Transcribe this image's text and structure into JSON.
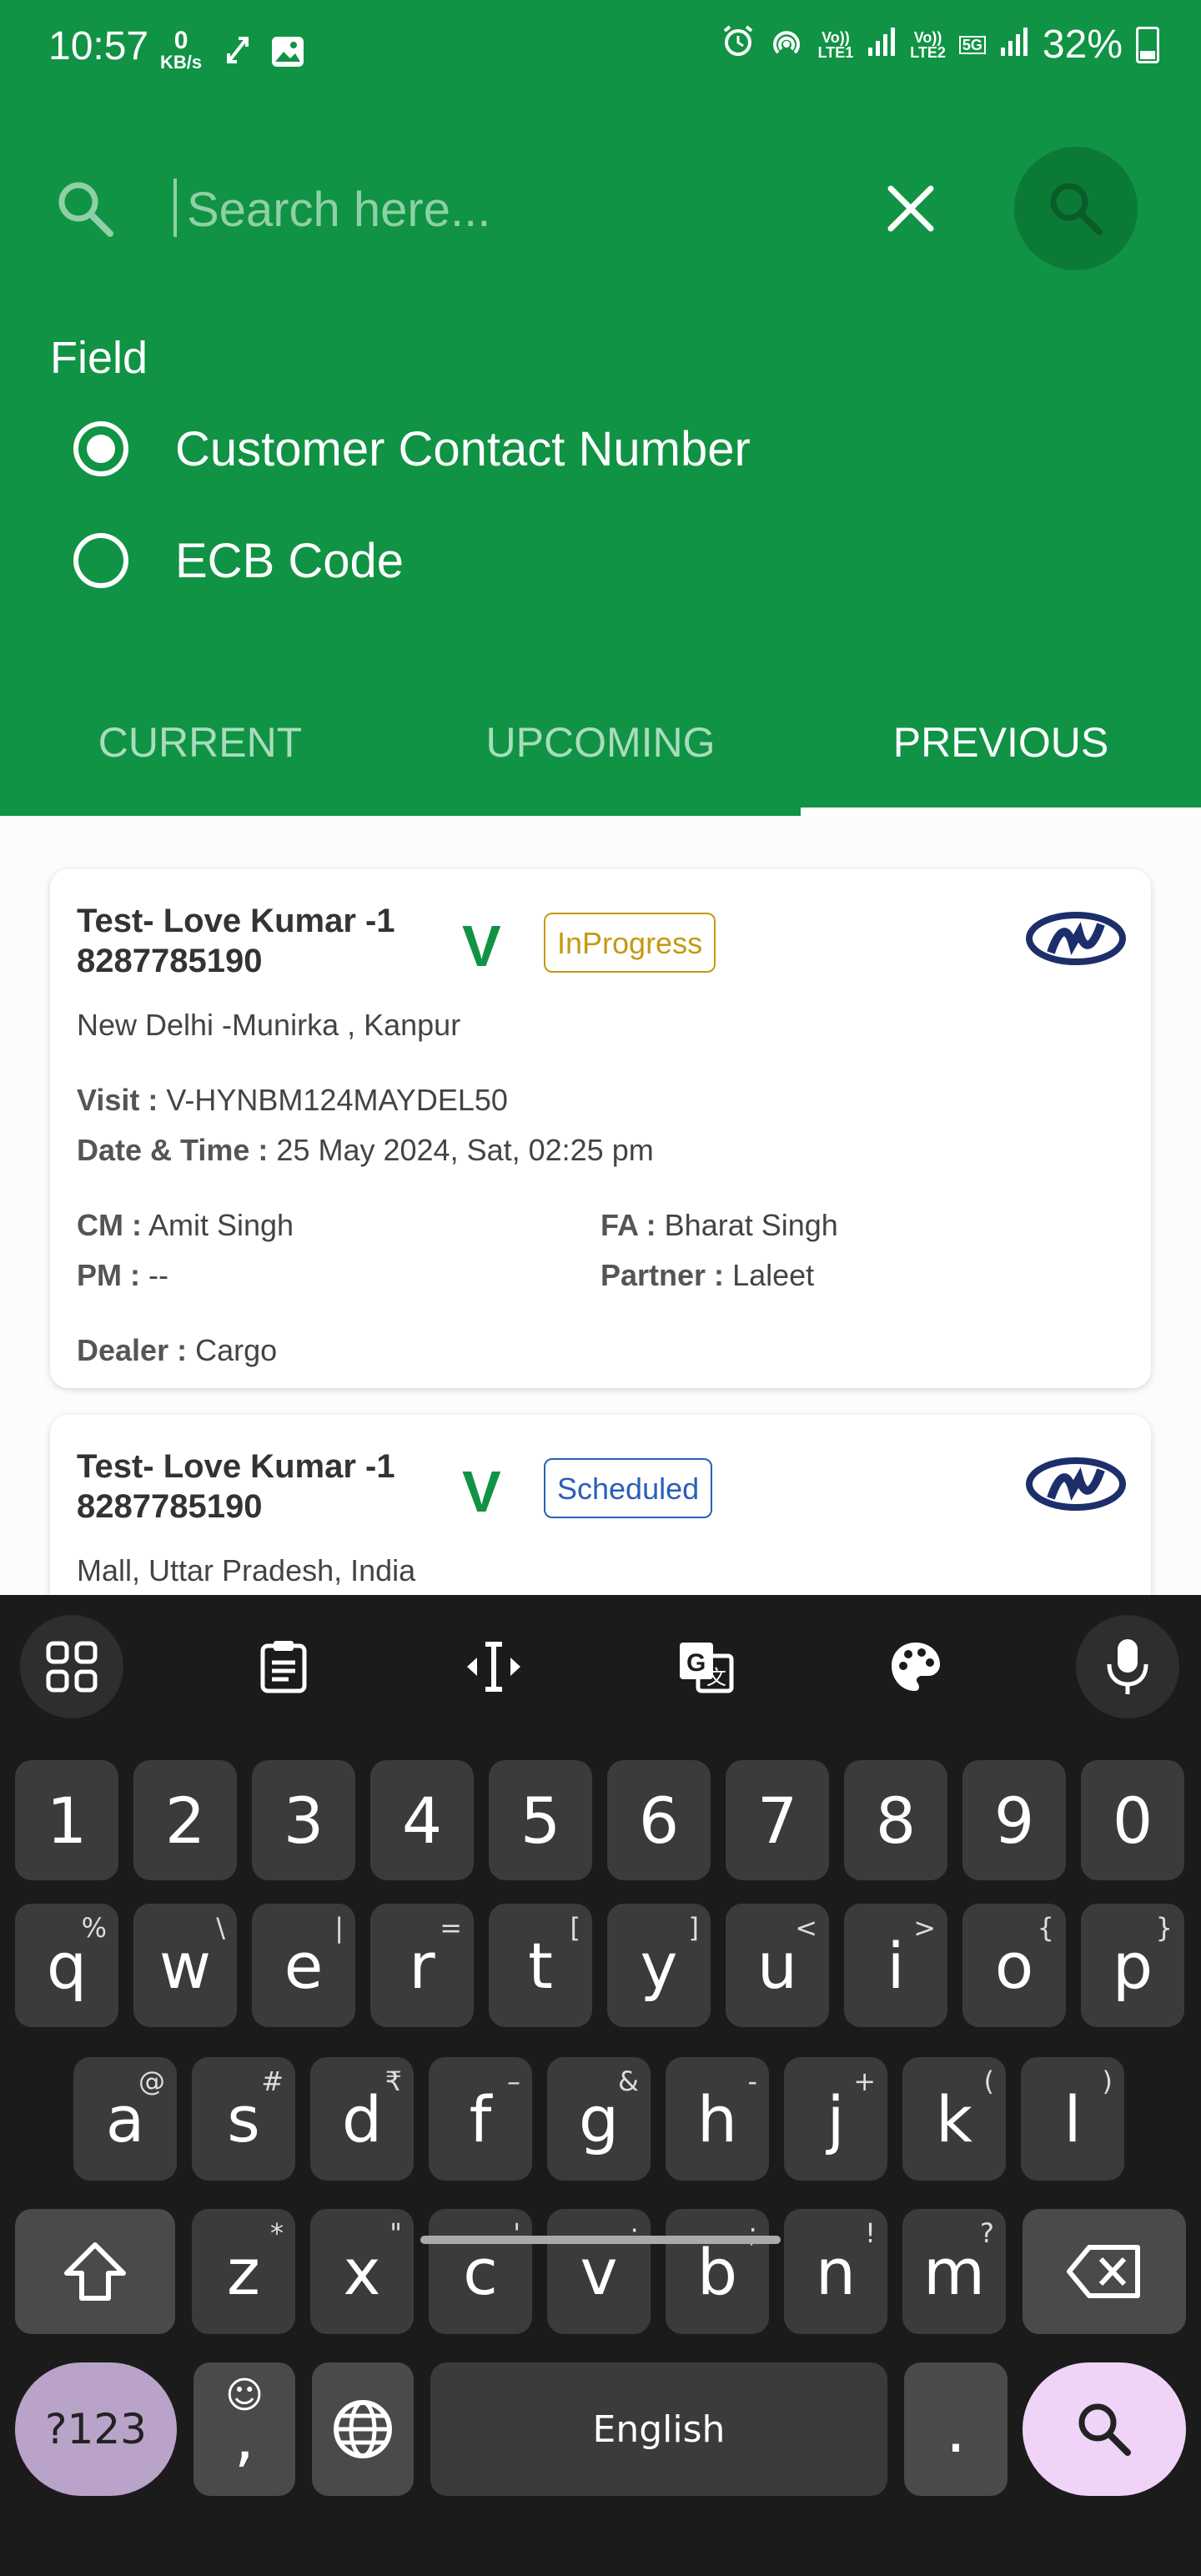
{
  "status_bar": {
    "time": "10:57",
    "net_speed_value": "0",
    "net_speed_unit": "KB/s",
    "sim1": "Vo))\nLTE1",
    "sim2": "Vo))\nLTE2",
    "net_5g": "5G",
    "battery": "32%"
  },
  "search": {
    "placeholder": "Search here..."
  },
  "field": {
    "title": "Field",
    "options": [
      {
        "label": "Customer Contact Number",
        "selected": true
      },
      {
        "label": "ECB Code",
        "selected": false
      }
    ]
  },
  "tabs": [
    {
      "label": "CURRENT",
      "active": false
    },
    {
      "label": "UPCOMING",
      "active": false
    },
    {
      "label": "PREVIOUS",
      "active": true
    }
  ],
  "cards": [
    {
      "name": "Test- Love Kumar -1",
      "phone": "8287785190",
      "v_mark": "V",
      "status": "InProgress",
      "status_color": "#c49a10",
      "location": "New Delhi -Munirka , Kanpur",
      "visit_label": "Visit :",
      "visit": "V-HYNBM124MAYDEL50",
      "datetime_label": "Date & Time :",
      "datetime": "25 May 2024, Sat, 02:25 pm",
      "cm_label": "CM :",
      "cm": "Amit Singh",
      "fa_label": "FA :",
      "fa": "Bharat Singh",
      "pm_label": "PM :",
      "pm": "--",
      "partner_label": "Partner :",
      "partner": "Laleet",
      "dealer_label": "Dealer :",
      "dealer": "Cargo"
    },
    {
      "name": "Test- Love Kumar -1",
      "phone": "8287785190",
      "v_mark": "V",
      "status": "Scheduled",
      "status_color": "#2b5fb8",
      "location": "Mall, Uttar Pradesh, India"
    }
  ],
  "keyboard": {
    "numbers": [
      "1",
      "2",
      "3",
      "4",
      "5",
      "6",
      "7",
      "8",
      "9",
      "0"
    ],
    "row1": [
      [
        "q",
        "%"
      ],
      [
        "w",
        "\\"
      ],
      [
        "e",
        "|"
      ],
      [
        "r",
        "="
      ],
      [
        "t",
        "["
      ],
      [
        "y",
        "]"
      ],
      [
        "u",
        "<"
      ],
      [
        "i",
        ">"
      ],
      [
        "o",
        "{"
      ],
      [
        "p",
        "}"
      ]
    ],
    "row2": [
      [
        "a",
        "@"
      ],
      [
        "s",
        "#"
      ],
      [
        "d",
        "₹"
      ],
      [
        "f",
        "–"
      ],
      [
        "g",
        "&"
      ],
      [
        "h",
        "-"
      ],
      [
        "j",
        "+"
      ],
      [
        "k",
        "("
      ],
      [
        "l",
        ")"
      ]
    ],
    "row3": [
      [
        "z",
        "*"
      ],
      [
        "x",
        "\""
      ],
      [
        "c",
        "'"
      ],
      [
        "v",
        ":"
      ],
      [
        "b",
        ";"
      ],
      [
        "n",
        "!"
      ],
      [
        "m",
        "?"
      ]
    ],
    "symbols_key": "?123",
    "comma": ",",
    "space": "English",
    "period": "."
  },
  "colors": {
    "header_green": "#109344",
    "search_button": "#0c7a37",
    "keyboard_bg": "#1b1b1b",
    "search_key": "#f0d4f8"
  }
}
